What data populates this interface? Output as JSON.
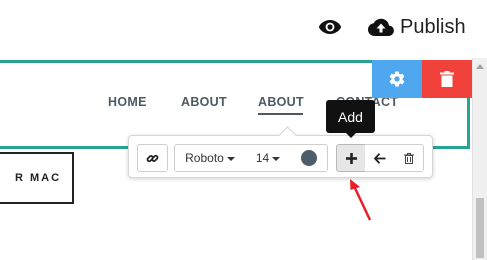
{
  "topbar": {
    "preview_icon": "eye-icon",
    "publish_icon": "cloud-upload-icon",
    "publish_label": "Publish"
  },
  "nav": {
    "items": [
      {
        "label": "HOME"
      },
      {
        "label": "ABOUT"
      },
      {
        "label": "ABOUT",
        "active": true
      },
      {
        "label": "CONTACT"
      }
    ],
    "accent_border_color": "#27a392",
    "text_color": "#4d5963"
  },
  "block_controls": {
    "settings_icon": "gear-icon",
    "settings_color": "#4fa8ef",
    "delete_icon": "trash-icon",
    "delete_color": "#f0413a"
  },
  "page_button": {
    "label": "R MAC"
  },
  "toolbar": {
    "link_icon": "link-icon",
    "font_family": "Roboto",
    "font_size": "14",
    "text_color_swatch": "#4d5d69",
    "add_icon": "plus-icon",
    "back_icon": "arrow-left-icon",
    "delete_icon": "trash-icon",
    "tooltip": "Add"
  },
  "annotation": {
    "arrow_color": "#e8202a"
  }
}
